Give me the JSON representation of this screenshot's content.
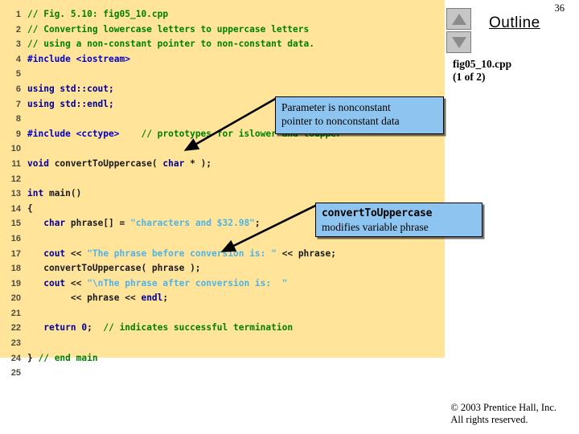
{
  "page_number": "36",
  "outline": {
    "title": "Outline",
    "subtitle_line1": "fig05_10.cpp",
    "subtitle_line2": "(1 of 2)",
    "scroll_up_icon": "triangle-up-icon",
    "scroll_down_icon": "triangle-down-icon"
  },
  "colors": {
    "code_background": "#ffe49a",
    "callout_background": "#8ec5f0",
    "comment": "#008000",
    "keyword": "#000099",
    "preprocessor": "#0000cc",
    "string": "#4fb3e8",
    "plain": "#1a1a1a",
    "line_number": "#4d4d3f",
    "button_face": "#c6c6c6"
  },
  "code": {
    "filename": "fig05_10.cpp",
    "lines": [
      {
        "n": "1",
        "tokens": [
          {
            "t": "// Fig. 5.10: fig05_10.cpp",
            "c": "cmt"
          }
        ]
      },
      {
        "n": "2",
        "tokens": [
          {
            "t": "// Converting lowercase letters to uppercase letters",
            "c": "cmt"
          }
        ]
      },
      {
        "n": "3",
        "tokens": [
          {
            "t": "// using a non-constant pointer to non-constant data.",
            "c": "cmt"
          }
        ]
      },
      {
        "n": "4",
        "tokens": [
          {
            "t": "#include <iostream>",
            "c": "pre"
          }
        ]
      },
      {
        "n": "5",
        "tokens": []
      },
      {
        "n": "6",
        "tokens": [
          {
            "t": "using std::cout;",
            "c": "kw"
          }
        ]
      },
      {
        "n": "7",
        "tokens": [
          {
            "t": "using std::endl;",
            "c": "kw"
          }
        ]
      },
      {
        "n": "8",
        "tokens": []
      },
      {
        "n": "9",
        "tokens": [
          {
            "t": "#include <cctype>",
            "c": "pre"
          },
          {
            "t": "    ",
            "c": "pln"
          },
          {
            "t": "// prototypes for islower and toupper",
            "c": "cmt"
          }
        ]
      },
      {
        "n": "10",
        "tokens": []
      },
      {
        "n": "11",
        "tokens": [
          {
            "t": "void ",
            "c": "kw"
          },
          {
            "t": "convertToUppercase( ",
            "c": "pln"
          },
          {
            "t": "char",
            "c": "kw"
          },
          {
            "t": " * );",
            "c": "pln"
          }
        ]
      },
      {
        "n": "12",
        "tokens": []
      },
      {
        "n": "13",
        "tokens": [
          {
            "t": "int ",
            "c": "kw"
          },
          {
            "t": "main()",
            "c": "pln"
          }
        ]
      },
      {
        "n": "14",
        "tokens": [
          {
            "t": "{",
            "c": "pln"
          }
        ]
      },
      {
        "n": "15",
        "tokens": [
          {
            "t": "   ",
            "c": "pln"
          },
          {
            "t": "char",
            "c": "kw"
          },
          {
            "t": " phrase[] = ",
            "c": "pln"
          },
          {
            "t": "\"characters and $32.98\"",
            "c": "str"
          },
          {
            "t": ";",
            "c": "pln"
          }
        ]
      },
      {
        "n": "16",
        "tokens": []
      },
      {
        "n": "17",
        "tokens": [
          {
            "t": "   ",
            "c": "pln"
          },
          {
            "t": "cout",
            "c": "kw"
          },
          {
            "t": " << ",
            "c": "pln"
          },
          {
            "t": "\"The phrase before conversion is: \"",
            "c": "str"
          },
          {
            "t": " << phrase;",
            "c": "pln"
          }
        ]
      },
      {
        "n": "18",
        "tokens": [
          {
            "t": "   convertToUppercase( phrase );",
            "c": "pln"
          }
        ]
      },
      {
        "n": "19",
        "tokens": [
          {
            "t": "   ",
            "c": "pln"
          },
          {
            "t": "cout",
            "c": "kw"
          },
          {
            "t": " << ",
            "c": "pln"
          },
          {
            "t": "\"\\nThe phrase after conversion is:  \"",
            "c": "str"
          }
        ]
      },
      {
        "n": "20",
        "tokens": [
          {
            "t": "        << phrase << ",
            "c": "pln"
          },
          {
            "t": "endl",
            "c": "kw"
          },
          {
            "t": ";",
            "c": "pln"
          }
        ]
      },
      {
        "n": "21",
        "tokens": []
      },
      {
        "n": "22",
        "tokens": [
          {
            "t": "   ",
            "c": "pln"
          },
          {
            "t": "return",
            "c": "kw"
          },
          {
            "t": " ",
            "c": "pln"
          },
          {
            "t": "0",
            "c": "num"
          },
          {
            "t": ";  ",
            "c": "pln"
          },
          {
            "t": "// indicates successful termination",
            "c": "cmt"
          }
        ]
      },
      {
        "n": "23",
        "tokens": []
      },
      {
        "n": "24",
        "tokens": [
          {
            "t": "} ",
            "c": "pln"
          },
          {
            "t": "// end main",
            "c": "cmt"
          }
        ]
      },
      {
        "n": "25",
        "tokens": []
      }
    ]
  },
  "callouts": [
    {
      "id": "parameter",
      "line1": "Parameter is nonconstant",
      "line2": "pointer to nonconstant data",
      "line1_mono": false
    },
    {
      "id": "modifies",
      "line1": "convertToUppercase",
      "line2": "modifies variable phrase",
      "line1_mono": true
    }
  ],
  "footer": {
    "copyright": "© 2003 Prentice Hall, Inc.",
    "rights": "All rights reserved."
  }
}
